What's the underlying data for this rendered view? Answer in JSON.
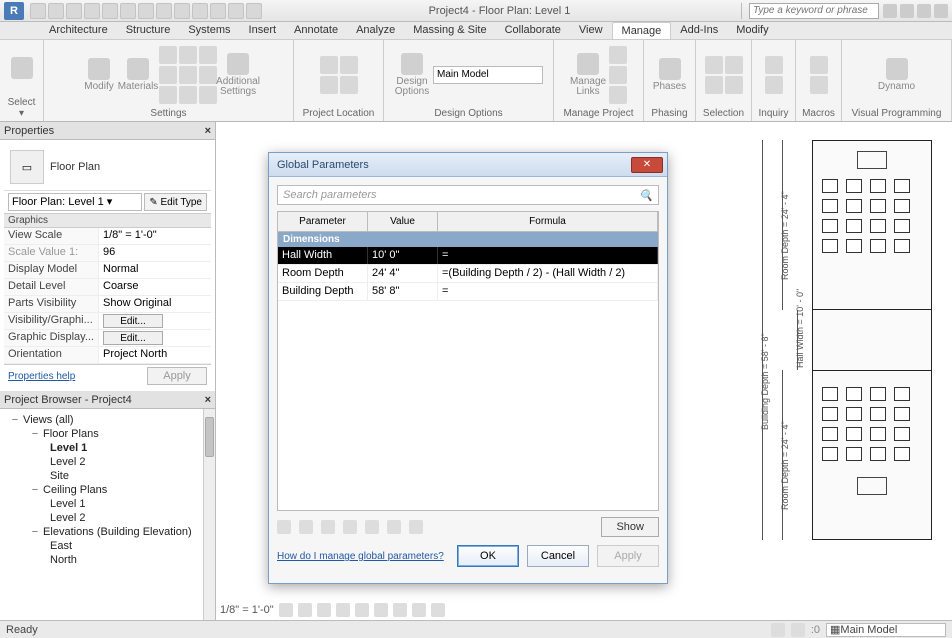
{
  "app": {
    "letter": "R",
    "title": "Project4 - Floor Plan: Level 1",
    "search_placeholder": "Type a keyword or phrase"
  },
  "ribbon": {
    "tabs": [
      "Architecture",
      "Structure",
      "Systems",
      "Insert",
      "Annotate",
      "Analyze",
      "Massing & Site",
      "Collaborate",
      "View",
      "Manage",
      "Add-Ins",
      "Modify"
    ],
    "active_tab": "Manage",
    "select_label": "Select ▾",
    "groups": {
      "settings": {
        "title": "Settings",
        "modify": "Modify",
        "materials": "Materials",
        "additional": "Additional\nSettings"
      },
      "project_location": {
        "title": "Project Location"
      },
      "design_options": {
        "title": "Design Options",
        "btn": "Design\nOptions",
        "combo": "Main Model"
      },
      "manage_project": {
        "title": "Manage Project",
        "btn": "Manage\nLinks"
      },
      "phasing": {
        "title": "Phasing",
        "btn": "Phases"
      },
      "selection": {
        "title": "Selection"
      },
      "inquiry": {
        "title": "Inquiry"
      },
      "macros": {
        "title": "Macros"
      },
      "vis_prog": {
        "title": "Visual Programming",
        "btn": "Dynamo"
      }
    }
  },
  "properties": {
    "title": "Properties",
    "type_name": "Floor Plan",
    "instance": "Floor Plan: Level 1",
    "edit_type": "✎ Edit Type",
    "group": "Graphics",
    "rows": [
      {
        "k": "View Scale",
        "v": "1/8\" = 1'-0\""
      },
      {
        "k": "Scale Value   1:",
        "v": "96",
        "g": true
      },
      {
        "k": "Display Model",
        "v": "Normal"
      },
      {
        "k": "Detail Level",
        "v": "Coarse"
      },
      {
        "k": "Parts Visibility",
        "v": "Show Original"
      },
      {
        "k": "Visibility/Graphi...",
        "v": "__btn__",
        "btn": "Edit..."
      },
      {
        "k": "Graphic Display...",
        "v": "__btn__",
        "btn": "Edit..."
      },
      {
        "k": "Orientation",
        "v": "Project North"
      }
    ],
    "help": "Properties help",
    "apply": "Apply"
  },
  "browser": {
    "title": "Project Browser - Project4",
    "tree": [
      {
        "lvl": 0,
        "label": "Views (all)",
        "exp": "−"
      },
      {
        "lvl": 1,
        "label": "Floor Plans",
        "exp": "−"
      },
      {
        "lvl": 2,
        "label": "Level 1",
        "bold": true
      },
      {
        "lvl": 2,
        "label": "Level 2"
      },
      {
        "lvl": 2,
        "label": "Site"
      },
      {
        "lvl": 1,
        "label": "Ceiling Plans",
        "exp": "−"
      },
      {
        "lvl": 2,
        "label": "Level 1"
      },
      {
        "lvl": 2,
        "label": "Level 2"
      },
      {
        "lvl": 1,
        "label": "Elevations (Building Elevation)",
        "exp": "−"
      },
      {
        "lvl": 2,
        "label": "East"
      },
      {
        "lvl": 2,
        "label": "North"
      }
    ]
  },
  "dialog": {
    "title": "Global Parameters",
    "search_placeholder": "Search parameters",
    "col_name": "Parameter",
    "col_val": "Value",
    "col_form": "Formula",
    "group": "Dimensions",
    "rows": [
      {
        "name": "Hall Width",
        "value": "10'  0\"",
        "formula": "=",
        "sel": true
      },
      {
        "name": "Room Depth",
        "value": "24'  4\"",
        "formula": "=(Building Depth / 2) - (Hall Width / 2)"
      },
      {
        "name": "Building Depth",
        "value": "58'  8\"",
        "formula": "="
      }
    ],
    "show": "Show",
    "link": "How do I manage global parameters?",
    "ok": "OK",
    "cancel": "Cancel",
    "apply": "Apply"
  },
  "canvas": {
    "scale_label": "1/8\" = 1'-0\"",
    "dims": {
      "room_depth_upper": "Room Depth = 24' - 4\"",
      "room_depth_lower": "Room Depth = 24' - 4\"",
      "building_depth": "Building Depth = 58' - 8\"",
      "hall_width": "Hall Width = 10' - 0\""
    }
  },
  "status": {
    "ready": "Ready",
    "main_model": "Main Model"
  }
}
